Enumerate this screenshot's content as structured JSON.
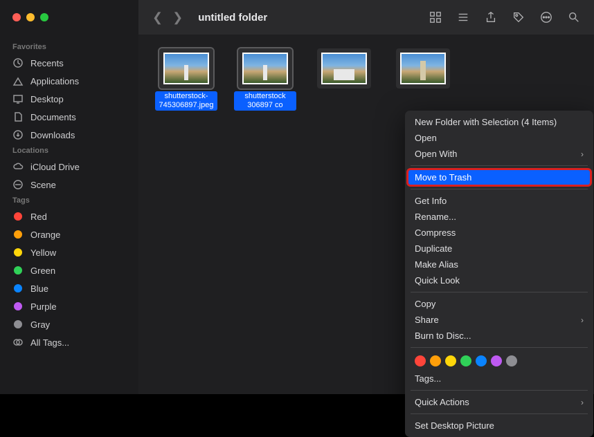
{
  "window": {
    "title": "untitled folder"
  },
  "sidebar": {
    "sections": [
      {
        "header": "Favorites",
        "items": [
          {
            "label": "Recents",
            "icon": "clock"
          },
          {
            "label": "Applications",
            "icon": "apps"
          },
          {
            "label": "Desktop",
            "icon": "desktop"
          },
          {
            "label": "Documents",
            "icon": "doc"
          },
          {
            "label": "Downloads",
            "icon": "download"
          }
        ]
      },
      {
        "header": "Locations",
        "items": [
          {
            "label": "iCloud Drive",
            "icon": "cloud"
          },
          {
            "label": "Scene",
            "icon": "drive"
          }
        ]
      },
      {
        "header": "Tags",
        "items": [
          {
            "label": "Red",
            "color": "#ff453a"
          },
          {
            "label": "Orange",
            "color": "#ff9f0a"
          },
          {
            "label": "Yellow",
            "color": "#ffd60a"
          },
          {
            "label": "Green",
            "color": "#30d158"
          },
          {
            "label": "Blue",
            "color": "#0a84ff"
          },
          {
            "label": "Purple",
            "color": "#bf5af2"
          },
          {
            "label": "Gray",
            "color": "#8e8e93"
          },
          {
            "label": "All Tags...",
            "allTags": true
          }
        ]
      }
    ]
  },
  "files": [
    {
      "label": "shutterstock-745306897.jpeg",
      "selected": true
    },
    {
      "label": "shutterstock 306897 co",
      "selected": true,
      "truncated": true
    },
    {
      "label": "",
      "selected": false
    },
    {
      "label": "",
      "selected": false
    }
  ],
  "contextMenu": {
    "groups": [
      [
        {
          "label": "New Folder with Selection (4 Items)"
        },
        {
          "label": "Open"
        },
        {
          "label": "Open With",
          "submenu": true
        }
      ],
      [
        {
          "label": "Move to Trash",
          "highlighted": true,
          "boxed": true
        }
      ],
      [
        {
          "label": "Get Info"
        },
        {
          "label": "Rename..."
        },
        {
          "label": "Compress"
        },
        {
          "label": "Duplicate"
        },
        {
          "label": "Make Alias"
        },
        {
          "label": "Quick Look"
        }
      ],
      [
        {
          "label": "Copy"
        },
        {
          "label": "Share",
          "submenu": true
        },
        {
          "label": "Burn to Disc..."
        }
      ],
      [
        {
          "tagColors": [
            "#ff453a",
            "#ff9f0a",
            "#ffd60a",
            "#30d158",
            "#0a84ff",
            "#bf5af2",
            "#8e8e93"
          ]
        },
        {
          "label": "Tags..."
        }
      ],
      [
        {
          "label": "Quick Actions",
          "submenu": true
        }
      ],
      [
        {
          "label": "Set Desktop Picture"
        }
      ]
    ]
  }
}
